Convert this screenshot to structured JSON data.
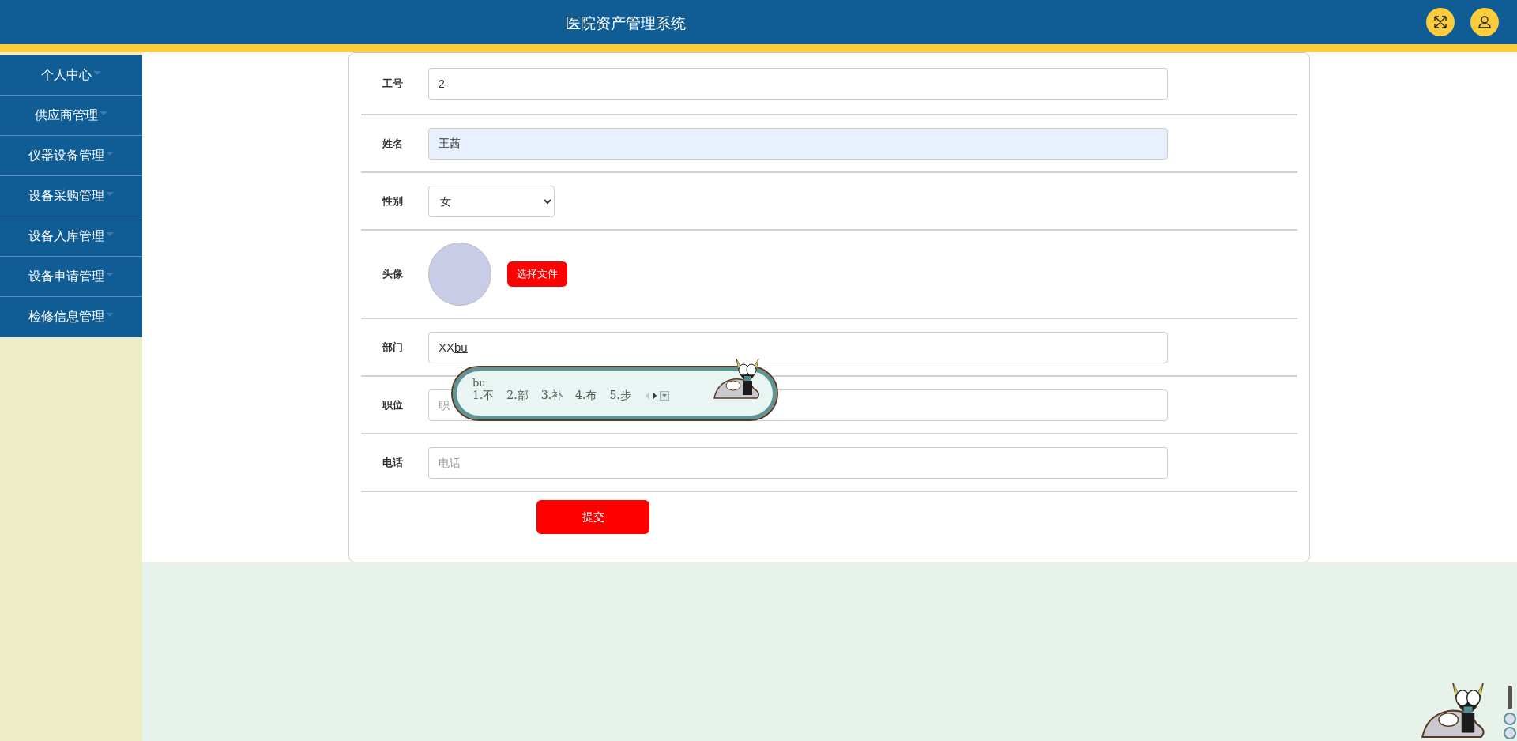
{
  "header": {
    "title": "医院资产管理系统"
  },
  "sidebar": {
    "items": [
      {
        "label": "个人中心"
      },
      {
        "label": "供应商管理"
      },
      {
        "label": "仪器设备管理"
      },
      {
        "label": "设备采购管理"
      },
      {
        "label": "设备入库管理"
      },
      {
        "label": "设备申请管理"
      },
      {
        "label": "检修信息管理"
      }
    ]
  },
  "form": {
    "fields": [
      {
        "kind": "text",
        "label": "工号",
        "value": "2",
        "highlighted": false
      },
      {
        "kind": "text",
        "label": "姓名",
        "value": "王茜",
        "highlighted": true
      },
      {
        "kind": "select",
        "label": "性别",
        "value": "女"
      },
      {
        "kind": "avatar",
        "label": "头像",
        "button": "选择文件"
      },
      {
        "kind": "composing",
        "label": "部门",
        "value": "XX",
        "composing": "bu"
      },
      {
        "kind": "text",
        "label": "职位",
        "placeholder": "职",
        "highlighted": false
      },
      {
        "kind": "text",
        "label": "电话",
        "placeholder": "电话",
        "highlighted": false
      }
    ],
    "submit": "提交"
  },
  "ime_popup": {
    "input": "bu",
    "candidates": [
      "1.不",
      "2.部",
      "3.补",
      "4.布",
      "5.步"
    ]
  }
}
